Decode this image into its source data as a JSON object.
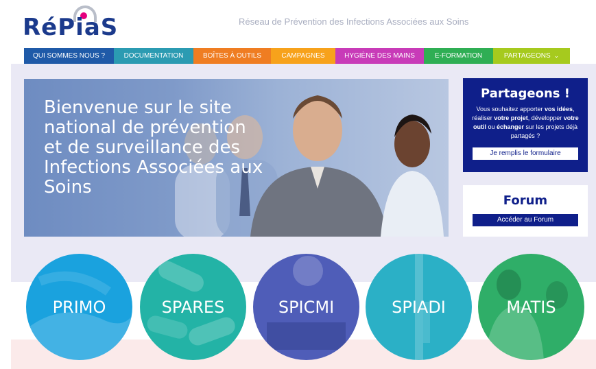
{
  "header": {
    "logo_text": "RéPiaS",
    "tagline": "Réseau de Prévention des Infections Associées aux Soins"
  },
  "nav": {
    "items": [
      {
        "label": "QUI SOMMES NOUS ?",
        "color": "#1f5aa8"
      },
      {
        "label": "DOCUMENTATION",
        "color": "#2b9bb2"
      },
      {
        "label": "BOÎTES À OUTILS",
        "color": "#ef7d22"
      },
      {
        "label": "CAMPAGNES",
        "color": "#f7a21b"
      },
      {
        "label": "HYGIÈNE DES MAINS",
        "color": "#c83bb8"
      },
      {
        "label": "E-FORMATION",
        "color": "#2fae54"
      },
      {
        "label": "PARTAGEONS",
        "color": "#a6ca1e",
        "icon": "chevron-down-icon"
      }
    ]
  },
  "hero": {
    "title": "Bienvenue sur le site national de prévention et de surveillance des Infections Associées aux Soins"
  },
  "partageons": {
    "title": "Partageons !",
    "text_1": "Vous souhaitez apporter ",
    "text_1b": "vos idées",
    "text_2": ", réaliser ",
    "text_2b": "votre projet",
    "text_3": ", développer ",
    "text_3b": "votre outil",
    "text_4": " ou ",
    "text_4b": "échanger",
    "text_5": " sur les projets déjà partagés ?",
    "button": "Je remplis le formulaire",
    "color": "#0f1f8a"
  },
  "forum": {
    "title": "Forum",
    "button": "Accéder au Forum"
  },
  "programs": [
    {
      "label": "PRIMO",
      "color": "#1aa2de"
    },
    {
      "label": "SPARES",
      "color": "#23b3a6"
    },
    {
      "label": "SPICMI",
      "color": "#4f5db8"
    },
    {
      "label": "SPIADI",
      "color": "#2bb0c6"
    },
    {
      "label": "MATIS",
      "color": "#2fae68"
    }
  ]
}
